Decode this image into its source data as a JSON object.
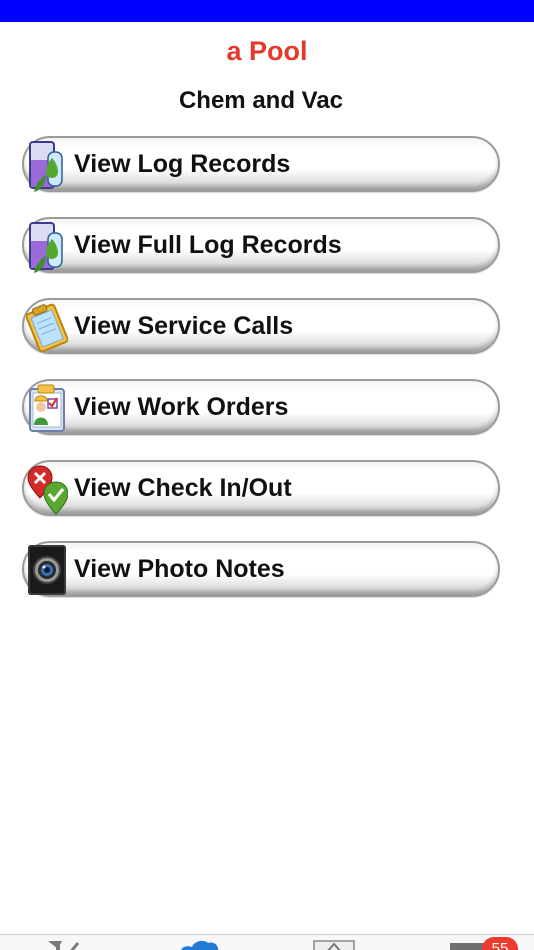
{
  "colors": {
    "status_bar": "#0000ff",
    "title": "#e53a2b",
    "badge": "#ec3b2e"
  },
  "header": {
    "title": "a Pool",
    "subtitle": "Chem and Vac"
  },
  "menu": {
    "items": [
      {
        "label": "View Log Records",
        "icon": "test-tube-icon"
      },
      {
        "label": "View Full Log Records",
        "icon": "test-tube-icon"
      },
      {
        "label": "View Service Calls",
        "icon": "clipboard-icon"
      },
      {
        "label": "View Work Orders",
        "icon": "work-order-icon"
      },
      {
        "label": "View Check In/Out",
        "icon": "check-in-out-icon"
      },
      {
        "label": "View Photo Notes",
        "icon": "camera-icon"
      }
    ]
  },
  "tab_bar": {
    "badge": "55",
    "icons": [
      "tools-icon",
      "cloud-icon",
      "home-icon",
      "mail-icon"
    ]
  }
}
